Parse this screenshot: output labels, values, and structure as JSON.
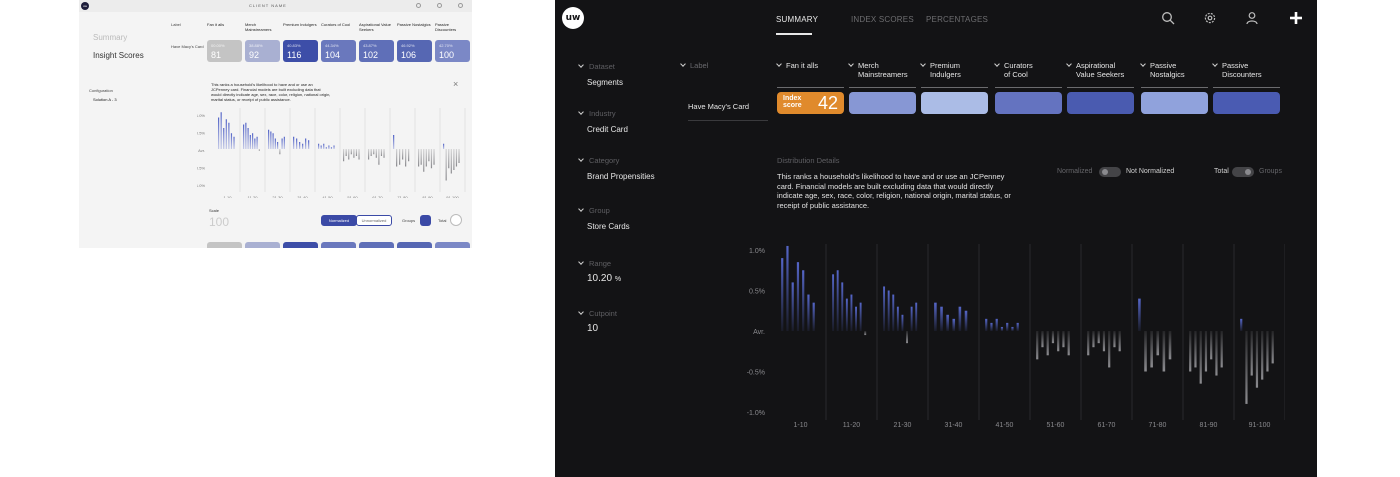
{
  "thumbnail": {
    "client_name": "CLIENT NAME",
    "summary": "Summary",
    "insight_scores": "Insight Scores",
    "label": "Label",
    "row_label": "Have Macy's Card",
    "configuration": "Configuration",
    "solution": "Solution A - 3",
    "description": "This ranks a household's likelihood to have and or use an JCPenney card. Financial models are built excluding data that would directly indicate age, sex, race, color, religion, national origin, marital status, or receipt of public assistance.",
    "scale_label": "Scale",
    "scale_value": "100",
    "normalized": "Normalized",
    "unnormalized": "Unnormalized",
    "groups": "Groups",
    "total": "Total",
    "segments": [
      {
        "name": "Fan it alls",
        "pct": "00.00%",
        "score": "81",
        "color": "#c4c4c4"
      },
      {
        "name": "Merch Mainstreamers",
        "pct": "38.88%",
        "score": "92",
        "color": "#a9b0d2"
      },
      {
        "name": "Premium Indulgers",
        "pct": "40.83%",
        "score": "116",
        "color": "#3d4ea8"
      },
      {
        "name": "Curators of Cool",
        "pct": "44.34%",
        "score": "104",
        "color": "#6a78bd"
      },
      {
        "name": "Aspirational Value Seekers",
        "pct": "43.87%",
        "score": "102",
        "color": "#5f6fb8"
      },
      {
        "name": "Passive Nostalgics",
        "pct": "46.92%",
        "score": "106",
        "color": "#5667b3"
      },
      {
        "name": "Passive Discounters",
        "pct": "42.70%",
        "score": "100",
        "color": "#7b88c6"
      }
    ],
    "ticks": [
      "1.0%",
      "0.5%",
      "Avr.",
      "-0.5%",
      "-1.0%"
    ],
    "x_labels": [
      "1-10",
      "11-20",
      "21-30",
      "31-40",
      "41-50",
      "51-60",
      "61-70",
      "71-80",
      "81-90",
      "91-100"
    ]
  },
  "nav": {
    "logo": "uw",
    "tabs": [
      {
        "label": "SUMMARY",
        "active": true
      },
      {
        "label": "INDEX SCORES",
        "active": false
      },
      {
        "label": "PERCENTAGES",
        "active": false
      }
    ],
    "icons": [
      "search-icon",
      "gear-icon",
      "user-icon",
      "plus-icon"
    ]
  },
  "sidebar": {
    "items": [
      {
        "label": "Dataset",
        "value": "Segments"
      },
      {
        "label": "Industry",
        "value": "Credit Card"
      },
      {
        "label": "Category",
        "value": "Brand Propensities"
      },
      {
        "label": "Group",
        "value": "Store Cards"
      },
      {
        "label": "Range",
        "value": "10.20",
        "unit": "%"
      },
      {
        "label": "Cutpoint",
        "value": "10"
      }
    ]
  },
  "table": {
    "label_header": "Label",
    "row_label": "Have Macy's Card",
    "index_caption_1": "Index",
    "index_caption_2": "score",
    "index_value": "42",
    "segments": [
      {
        "line1": "Fan it alls",
        "line2": "",
        "color": "#e08a2c"
      },
      {
        "line1": "Merch",
        "line2": "Mainstreamers",
        "color": "#8797d4"
      },
      {
        "line1": "Premium",
        "line2": "Indulgers",
        "color": "#abbce6"
      },
      {
        "line1": "Curators",
        "line2": "of Cool",
        "color": "#6473c0"
      },
      {
        "line1": "Aspirational",
        "line2": "Value Seekers",
        "color": "#4a5bb0"
      },
      {
        "line1": "Passive",
        "line2": "Nostalgics",
        "color": "#90a2dc"
      },
      {
        "line1": "Passive",
        "line2": "Discounters",
        "color": "#4a5bb2"
      }
    ]
  },
  "distribution": {
    "title": "Distribution Details",
    "description": "This ranks a household's likelihood to have and or use an JCPenney card. Financial models are built excluding data that would directly indicate age, sex, race, color, religion, national origin, marital status, or receipt of public assistance.",
    "normalized": "Normalized",
    "not_normalized": "Not Normalized",
    "total": "Total",
    "groups": "Groups"
  },
  "chart_data": {
    "type": "bar",
    "y_ticks": [
      "1.0%",
      "0.5%",
      "Avr.",
      "-0.5%",
      "-1.0%"
    ],
    "ylim": [
      -1.0,
      1.0
    ],
    "categories": [
      "1-10",
      "11-20",
      "21-30",
      "31-40",
      "41-50",
      "51-60",
      "61-70",
      "71-80",
      "81-90",
      "91-100"
    ],
    "groups": [
      [
        0.9,
        1.05,
        0.6,
        0.85,
        0.75,
        0.45,
        0.35
      ],
      [
        0.7,
        0.75,
        0.6,
        0.4,
        0.45,
        0.3,
        0.35,
        -0.05
      ],
      [
        0.55,
        0.5,
        0.45,
        0.3,
        0.2,
        -0.15,
        0.3,
        0.35
      ],
      [
        0.35,
        0.3,
        0.2,
        0.15,
        0.3,
        0.25
      ],
      [
        0.15,
        0.1,
        0.15,
        0.05,
        0.1,
        0.05,
        0.1
      ],
      [
        -0.35,
        -0.2,
        -0.3,
        -0.15,
        -0.25,
        -0.2,
        -0.3
      ],
      [
        -0.3,
        -0.2,
        -0.15,
        -0.25,
        -0.45,
        -0.2,
        -0.25
      ],
      [
        0.4,
        -0.5,
        -0.45,
        -0.3,
        -0.5,
        -0.35
      ],
      [
        -0.5,
        -0.45,
        -0.65,
        -0.5,
        -0.35,
        -0.55,
        -0.45
      ],
      [
        0.15,
        -0.9,
        -0.55,
        -0.7,
        -0.6,
        -0.5,
        -0.4
      ]
    ],
    "colors": {
      "positive": "#5566c8",
      "negative": "#8c8c90"
    }
  }
}
